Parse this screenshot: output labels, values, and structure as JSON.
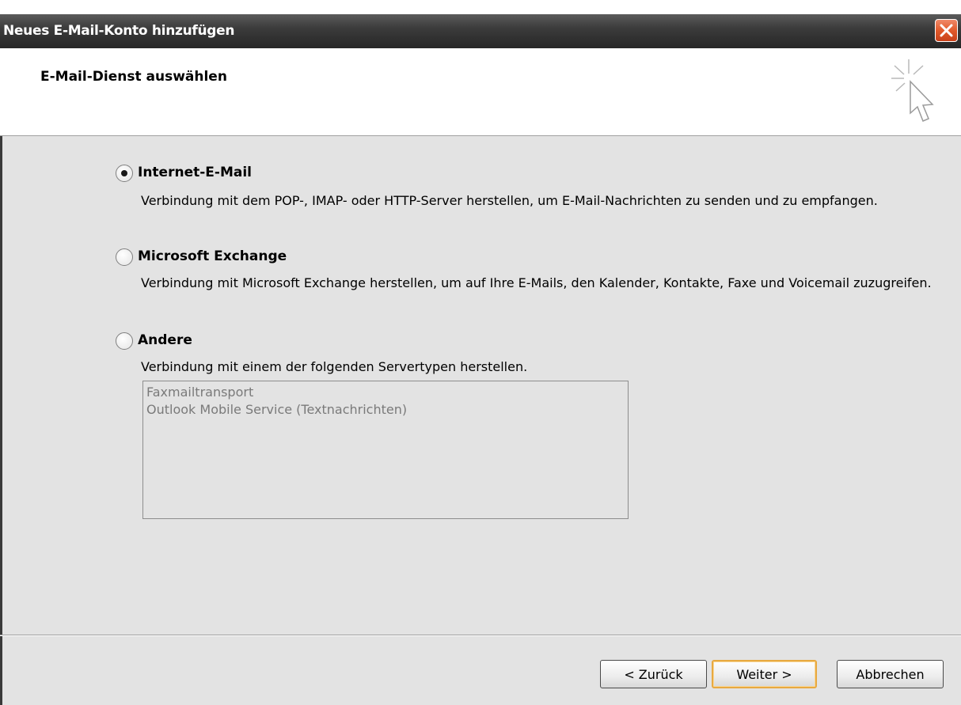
{
  "window": {
    "title": "Neues E-Mail-Konto hinzufügen"
  },
  "header": {
    "title": "E-Mail-Dienst auswählen"
  },
  "options": [
    {
      "label": "Internet-E-Mail",
      "description": "Verbindung mit dem POP-, IMAP- oder HTTP-Server herstellen, um E-Mail-Nachrichten zu senden und zu empfangen.",
      "selected": true
    },
    {
      "label": "Microsoft Exchange",
      "description": "Verbindung mit Microsoft Exchange herstellen, um auf Ihre E-Mails, den Kalender, Kontakte, Faxe und Voicemail zuzugreifen.",
      "selected": false
    },
    {
      "label": "Andere",
      "description": "Verbindung mit einem der folgenden Servertypen herstellen.",
      "selected": false
    }
  ],
  "server_list": [
    "Faxmailtransport",
    "Outlook Mobile Service (Textnachrichten)"
  ],
  "buttons": {
    "back": "< Zurück",
    "next": "Weiter >",
    "cancel": "Abbrechen"
  },
  "icons": {
    "close": "close-icon",
    "wizard": "cursor-sparkle-icon"
  }
}
